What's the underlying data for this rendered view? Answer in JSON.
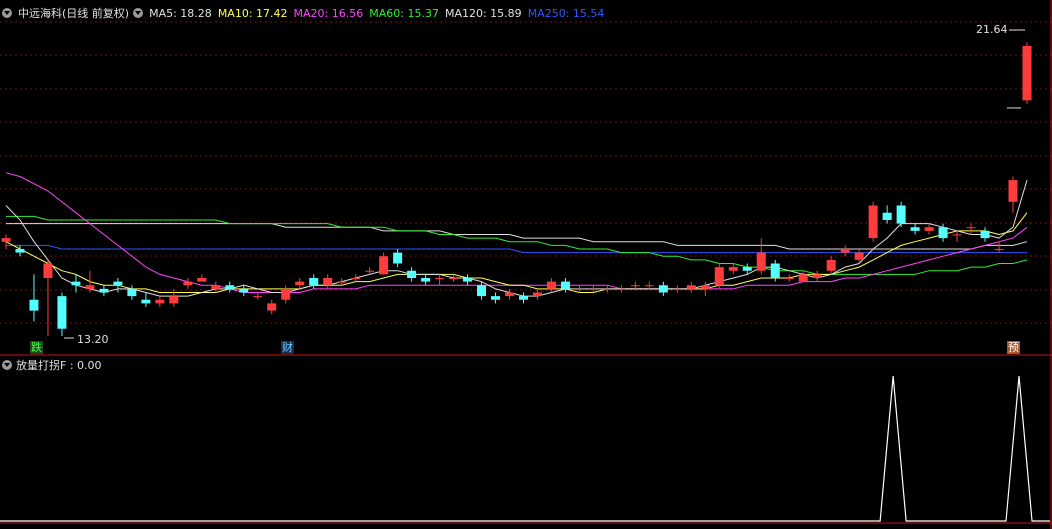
{
  "header": {
    "title": "中远海科(日线 前复权)",
    "ma": [
      {
        "label": "MA5: 18.28",
        "color": "#e0e0e0"
      },
      {
        "label": "MA10: 17.42",
        "color": "#ffff55"
      },
      {
        "label": "MA20: 16.56",
        "color": "#ff44ff"
      },
      {
        "label": "MA60: 15.37",
        "color": "#33ee33"
      },
      {
        "label": "MA120: 15.89",
        "color": "#e0e0e0"
      },
      {
        "label": "MA250: 15.54",
        "color": "#3355ff"
      }
    ]
  },
  "price_labels": {
    "high": "21.64",
    "low": "13.20"
  },
  "tags": [
    {
      "label": "跌",
      "color": "#44ff44",
      "bg": "#1a4a1a"
    },
    {
      "label": "财",
      "color": "#66ccff",
      "bg": "#1a2a4a"
    },
    {
      "label": "预",
      "color": "#ffffff",
      "bg": "#aa5522"
    }
  ],
  "indicator": {
    "label": "放量打拐F : 0.00"
  },
  "colors": {
    "up": "#ff3b3b",
    "down": "#54ffff",
    "grid": "#7a1010",
    "separator": "#c01818",
    "indicator_line": "#ffffff"
  },
  "chart_data": {
    "type": "candlestick",
    "price_axis_labels": [
      "21.64",
      "13.20"
    ],
    "candles": [
      [
        15.8,
        15.9,
        16.0,
        15.6
      ],
      [
        15.6,
        15.5,
        15.7,
        15.4
      ],
      [
        14.2,
        13.9,
        14.9,
        13.6
      ],
      [
        14.8,
        15.2,
        15.3,
        13.2
      ],
      [
        14.3,
        13.4,
        14.4,
        13.2
      ],
      [
        14.7,
        14.6,
        14.9,
        14.4
      ],
      [
        14.5,
        14.6,
        15.0,
        14.4
      ],
      [
        14.5,
        14.4,
        14.6,
        14.3
      ],
      [
        14.7,
        14.6,
        14.8,
        14.4
      ],
      [
        14.5,
        14.3,
        14.6,
        14.2
      ],
      [
        14.2,
        14.1,
        14.4,
        14.0
      ],
      [
        14.1,
        14.2,
        14.3,
        14.0
      ],
      [
        14.1,
        14.3,
        14.5,
        14.0
      ],
      [
        14.6,
        14.7,
        14.8,
        14.5
      ],
      [
        14.7,
        14.8,
        14.9,
        14.7
      ],
      [
        14.5,
        14.6,
        14.7,
        14.4
      ],
      [
        14.6,
        14.5,
        14.7,
        14.4
      ],
      [
        14.5,
        14.4,
        14.6,
        14.3
      ],
      [
        14.3,
        14.3,
        14.4,
        14.2
      ],
      [
        13.9,
        14.1,
        14.2,
        13.8
      ],
      [
        14.2,
        14.5,
        14.6,
        14.1
      ],
      [
        14.6,
        14.7,
        14.8,
        14.5
      ],
      [
        14.8,
        14.6,
        14.9,
        14.5
      ],
      [
        14.6,
        14.8,
        14.9,
        14.5
      ],
      [
        14.7,
        14.7,
        14.8,
        14.6
      ],
      [
        14.8,
        14.8,
        14.9,
        14.7
      ],
      [
        15.0,
        15.0,
        15.1,
        14.9
      ],
      [
        14.9,
        15.4,
        15.5,
        14.9
      ],
      [
        15.5,
        15.2,
        15.6,
        15.1
      ],
      [
        15.0,
        14.8,
        15.1,
        14.7
      ],
      [
        14.8,
        14.7,
        14.9,
        14.6
      ],
      [
        14.8,
        14.8,
        14.9,
        14.6
      ],
      [
        14.8,
        14.8,
        14.9,
        14.7
      ],
      [
        14.8,
        14.7,
        14.9,
        14.6
      ],
      [
        14.6,
        14.3,
        14.7,
        14.2
      ],
      [
        14.3,
        14.2,
        14.4,
        14.1
      ],
      [
        14.3,
        14.4,
        14.5,
        14.2
      ],
      [
        14.3,
        14.2,
        14.4,
        14.1
      ],
      [
        14.3,
        14.4,
        14.5,
        14.2
      ],
      [
        14.5,
        14.7,
        14.8,
        14.4
      ],
      [
        14.7,
        14.5,
        14.8,
        14.4
      ],
      [
        14.5,
        14.5,
        14.6,
        14.4
      ],
      [
        14.5,
        14.5,
        14.6,
        14.4
      ],
      [
        14.5,
        14.5,
        14.6,
        14.4
      ],
      [
        14.5,
        14.5,
        14.6,
        14.4
      ],
      [
        14.6,
        14.6,
        14.7,
        14.5
      ],
      [
        14.6,
        14.6,
        14.7,
        14.5
      ],
      [
        14.6,
        14.4,
        14.7,
        14.3
      ],
      [
        14.5,
        14.5,
        14.6,
        14.4
      ],
      [
        14.5,
        14.6,
        14.7,
        14.4
      ],
      [
        14.5,
        14.6,
        14.7,
        14.3
      ],
      [
        14.6,
        15.1,
        15.2,
        14.5
      ],
      [
        15.0,
        15.1,
        15.2,
        14.9
      ],
      [
        15.1,
        15.0,
        15.2,
        14.9
      ],
      [
        15.0,
        15.5,
        15.9,
        14.9
      ],
      [
        15.2,
        14.8,
        15.3,
        14.7
      ],
      [
        14.8,
        14.8,
        14.9,
        14.7
      ],
      [
        14.7,
        14.9,
        15.0,
        14.7
      ],
      [
        14.8,
        14.9,
        15.0,
        14.7
      ],
      [
        15.0,
        15.3,
        15.4,
        14.9
      ],
      [
        15.5,
        15.6,
        15.7,
        15.4
      ],
      [
        15.3,
        15.5,
        15.6,
        15.2
      ],
      [
        15.9,
        16.8,
        16.9,
        15.8
      ],
      [
        16.6,
        16.4,
        16.8,
        16.3
      ],
      [
        16.8,
        16.3,
        16.9,
        16.2
      ],
      [
        16.2,
        16.1,
        16.3,
        16.0
      ],
      [
        16.1,
        16.2,
        16.3,
        16.0
      ],
      [
        16.2,
        15.9,
        16.3,
        15.8
      ],
      [
        16.0,
        16.0,
        16.1,
        15.8
      ],
      [
        16.2,
        16.2,
        16.3,
        16.0
      ],
      [
        16.1,
        15.9,
        16.2,
        15.8
      ],
      [
        15.6,
        15.6,
        15.8,
        15.5
      ],
      [
        16.9,
        17.5,
        17.6,
        16.6
      ],
      [
        19.7,
        21.2,
        21.3,
        19.6
      ]
    ],
    "ma5": [
      16.8,
      16.4,
      15.8,
      15.3,
      14.8,
      14.6,
      14.5,
      14.4,
      14.5,
      14.5,
      14.4,
      14.3,
      14.3,
      14.3,
      14.4,
      14.5,
      14.5,
      14.6,
      14.5,
      14.4,
      14.4,
      14.5,
      14.6,
      14.6,
      14.7,
      14.8,
      14.9,
      15.0,
      15.0,
      14.9,
      14.9,
      14.9,
      14.8,
      14.8,
      14.7,
      14.5,
      14.4,
      14.3,
      14.3,
      14.4,
      14.5,
      14.5,
      14.5,
      14.5,
      14.5,
      14.5,
      14.5,
      14.5,
      14.5,
      14.5,
      14.6,
      14.7,
      14.8,
      14.9,
      15.1,
      15.1,
      15.0,
      14.9,
      14.8,
      14.9,
      15.1,
      15.2,
      15.6,
      15.9,
      16.3,
      16.3,
      16.3,
      16.2,
      16.1,
      16.0,
      16.0,
      15.9,
      16.2,
      17.5
    ],
    "ma10": [
      15.8,
      15.6,
      15.4,
      15.2,
      15.0,
      14.9,
      14.7,
      14.6,
      14.6,
      14.5,
      14.5,
      14.4,
      14.4,
      14.4,
      14.4,
      14.4,
      14.5,
      14.5,
      14.5,
      14.5,
      14.5,
      14.5,
      14.6,
      14.6,
      14.6,
      14.7,
      14.7,
      14.8,
      14.9,
      14.9,
      14.9,
      14.9,
      14.9,
      14.8,
      14.8,
      14.7,
      14.6,
      14.6,
      14.5,
      14.5,
      14.5,
      14.4,
      14.4,
      14.5,
      14.5,
      14.5,
      14.5,
      14.5,
      14.5,
      14.5,
      14.5,
      14.6,
      14.6,
      14.7,
      14.8,
      14.8,
      14.8,
      14.9,
      14.9,
      14.9,
      15.0,
      15.1,
      15.3,
      15.5,
      15.7,
      15.8,
      15.9,
      16.0,
      16.1,
      16.1,
      16.1,
      16.0,
      16.1,
      16.6
    ],
    "ma20": [
      17.7,
      17.6,
      17.4,
      17.2,
      16.9,
      16.6,
      16.3,
      16.0,
      15.7,
      15.4,
      15.1,
      14.9,
      14.8,
      14.7,
      14.6,
      14.6,
      14.5,
      14.4,
      14.4,
      14.4,
      14.4,
      14.4,
      14.5,
      14.5,
      14.5,
      14.5,
      14.6,
      14.6,
      14.6,
      14.6,
      14.6,
      14.6,
      14.6,
      14.6,
      14.6,
      14.6,
      14.6,
      14.6,
      14.6,
      14.6,
      14.6,
      14.6,
      14.6,
      14.6,
      14.5,
      14.5,
      14.5,
      14.5,
      14.5,
      14.5,
      14.5,
      14.5,
      14.5,
      14.6,
      14.6,
      14.6,
      14.6,
      14.7,
      14.7,
      14.7,
      14.8,
      14.8,
      14.9,
      15.0,
      15.1,
      15.2,
      15.3,
      15.4,
      15.5,
      15.6,
      15.7,
      15.8,
      15.9,
      16.2
    ],
    "ma60": [
      16.5,
      16.5,
      16.5,
      16.4,
      16.4,
      16.4,
      16.4,
      16.4,
      16.4,
      16.4,
      16.4,
      16.4,
      16.4,
      16.4,
      16.4,
      16.4,
      16.3,
      16.3,
      16.3,
      16.3,
      16.3,
      16.3,
      16.3,
      16.3,
      16.2,
      16.2,
      16.2,
      16.2,
      16.1,
      16.1,
      16.1,
      16.0,
      16.0,
      15.9,
      15.9,
      15.9,
      15.8,
      15.8,
      15.8,
      15.7,
      15.7,
      15.6,
      15.6,
      15.6,
      15.5,
      15.5,
      15.5,
      15.4,
      15.4,
      15.3,
      15.3,
      15.2,
      15.2,
      15.1,
      15.1,
      15.0,
      15.0,
      15.0,
      14.9,
      14.9,
      14.9,
      14.9,
      14.9,
      14.9,
      14.9,
      14.9,
      15.0,
      15.0,
      15.0,
      15.1,
      15.1,
      15.2,
      15.2,
      15.3
    ],
    "ma120": [
      16.3,
      16.3,
      16.3,
      16.3,
      16.3,
      16.3,
      16.3,
      16.3,
      16.3,
      16.3,
      16.3,
      16.3,
      16.3,
      16.3,
      16.3,
      16.3,
      16.3,
      16.3,
      16.3,
      16.3,
      16.2,
      16.2,
      16.2,
      16.2,
      16.2,
      16.2,
      16.2,
      16.1,
      16.1,
      16.1,
      16.1,
      16.1,
      16.0,
      16.0,
      16.0,
      16.0,
      16.0,
      15.9,
      15.9,
      15.9,
      15.9,
      15.9,
      15.8,
      15.8,
      15.8,
      15.8,
      15.8,
      15.8,
      15.7,
      15.7,
      15.7,
      15.7,
      15.7,
      15.7,
      15.7,
      15.7,
      15.6,
      15.6,
      15.6,
      15.6,
      15.6,
      15.6,
      15.6,
      15.6,
      15.6,
      15.6,
      15.6,
      15.6,
      15.6,
      15.6,
      15.7,
      15.7,
      15.7,
      15.8
    ],
    "ma250": [
      15.7,
      15.7,
      15.7,
      15.7,
      15.6,
      15.6,
      15.6,
      15.6,
      15.6,
      15.6,
      15.6,
      15.6,
      15.6,
      15.6,
      15.6,
      15.6,
      15.6,
      15.6,
      15.6,
      15.6,
      15.6,
      15.6,
      15.6,
      15.6,
      15.6,
      15.6,
      15.6,
      15.6,
      15.6,
      15.6,
      15.6,
      15.6,
      15.6,
      15.6,
      15.6,
      15.6,
      15.6,
      15.5,
      15.5,
      15.5,
      15.5,
      15.5,
      15.5,
      15.5,
      15.5,
      15.5,
      15.5,
      15.5,
      15.5,
      15.5,
      15.5,
      15.5,
      15.5,
      15.5,
      15.5,
      15.5,
      15.5,
      15.5,
      15.5,
      15.5,
      15.5,
      15.5,
      15.5,
      15.5,
      15.5,
      15.5,
      15.5,
      15.5,
      15.5,
      15.5,
      15.5,
      15.5,
      15.5,
      15.5
    ],
    "indicator_spikes": [
      63,
      72
    ]
  }
}
